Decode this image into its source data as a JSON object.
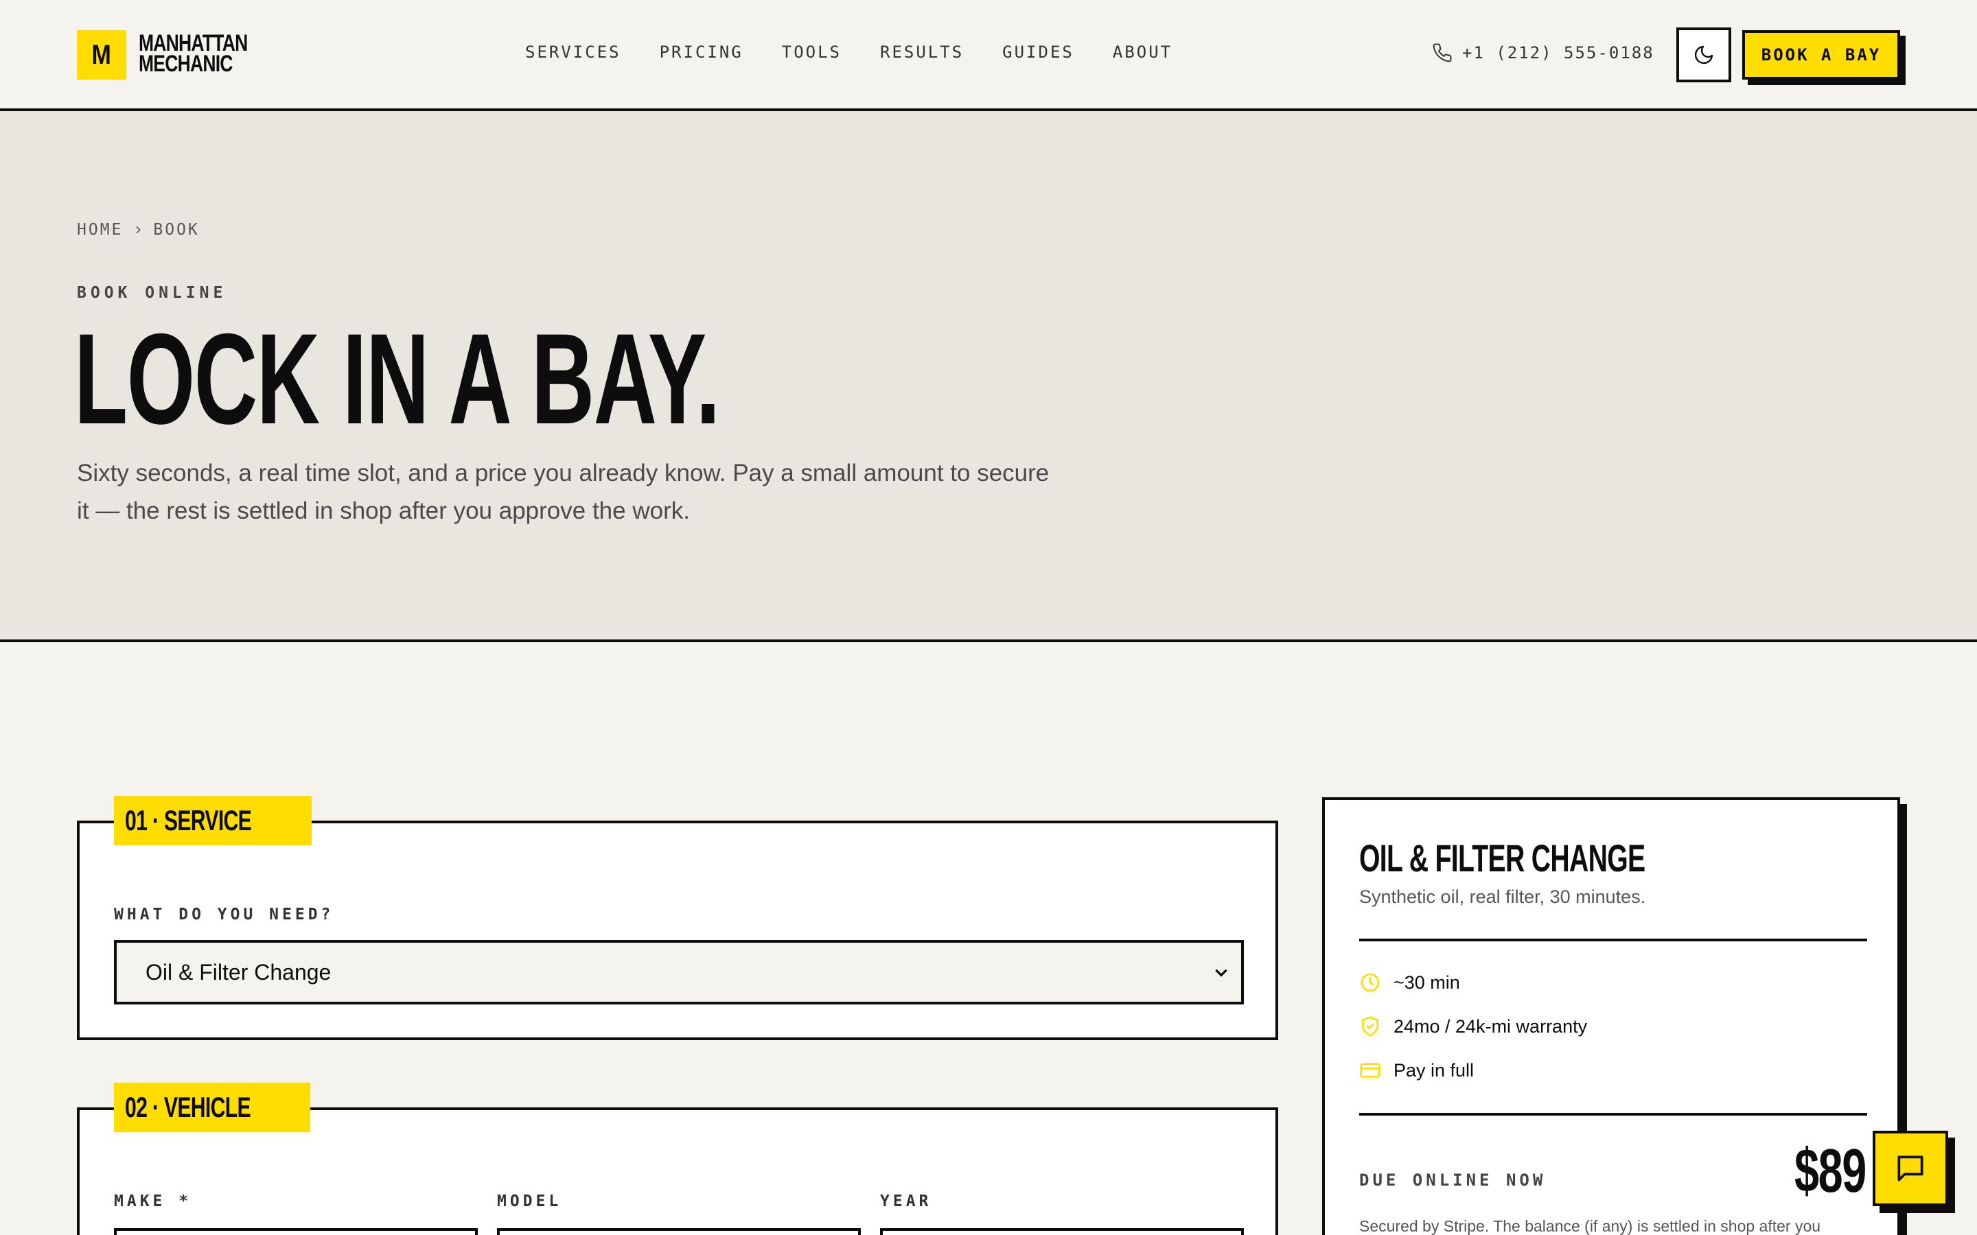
{
  "brand": {
    "mark": "M",
    "line1": "MANHATTAN",
    "line2": "MECHANIC"
  },
  "nav": [
    "SERVICES",
    "PRICING",
    "TOOLS",
    "RESULTS",
    "GUIDES",
    "ABOUT"
  ],
  "header": {
    "phone": "+1 (212) 555-0188",
    "cta": "BOOK A BAY",
    "theme_icon": "moon-icon"
  },
  "hero": {
    "breadcrumb": [
      "HOME",
      "BOOK"
    ],
    "eyebrow": "BOOK ONLINE",
    "title": "LOCK IN A BAY.",
    "subtitle": "Sixty seconds, a real time slot, and a price you already know. Pay a small amount to secure it — the rest is settled in shop after you approve the work."
  },
  "service": {
    "tag": "01 · SERVICE",
    "label": "WHAT DO YOU NEED?",
    "selected": "Oil & Filter Change"
  },
  "vehicle": {
    "tag": "02 · VEHICLE",
    "make_label": "MAKE *",
    "model_label": "MODEL",
    "year_label": "YEAR"
  },
  "summary": {
    "title": "OIL & FILTER CHANGE",
    "subtitle": "Synthetic oil, real filter, 30 minutes.",
    "meta": [
      {
        "icon": "clock-icon",
        "text": "~30 min"
      },
      {
        "icon": "shield-check-icon",
        "text": "24mo / 24k-mi warranty"
      },
      {
        "icon": "credit-card-icon",
        "text": "Pay in full"
      }
    ],
    "due_label": "DUE ONLINE NOW",
    "due_price": "$89",
    "note": "Secured by Stripe. The balance (if any) is settled in shop after you"
  },
  "colors": {
    "accent": "#ffdd00",
    "ink": "#0d0d0d",
    "paper": "#f4f3ee",
    "hero_bg": "#e8e6df"
  }
}
